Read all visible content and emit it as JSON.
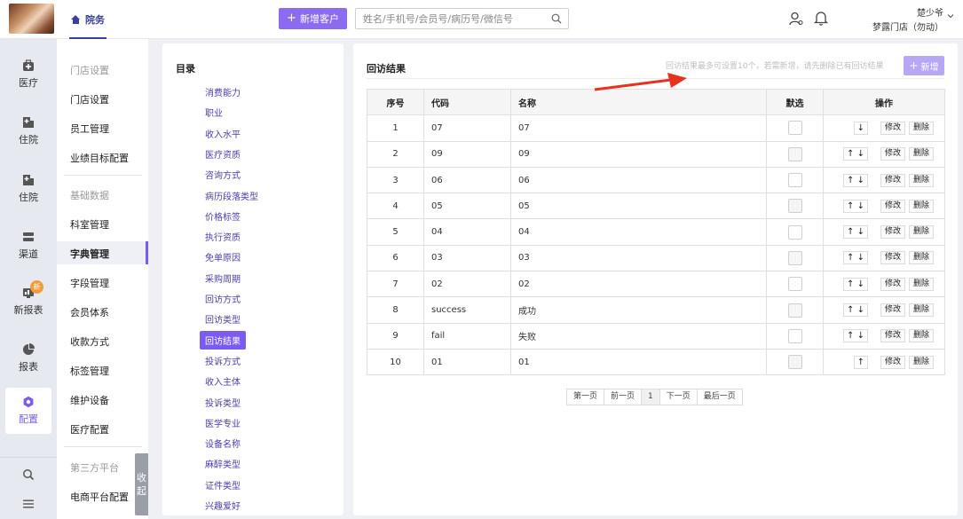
{
  "header": {
    "home_tab": "院务",
    "add_customer": "新增客户",
    "search_placeholder": "姓名/手机号/会员号/病历号/微信号",
    "user_name": "楚少爷",
    "store_name": "梦露门店（勿动）"
  },
  "nav": [
    {
      "label": "医疗",
      "icon": "medical-kit-icon"
    },
    {
      "label": "住院",
      "icon": "hospital-icon"
    },
    {
      "label": "住院",
      "icon": "hospital-icon"
    },
    {
      "label": "渠道",
      "icon": "channel-icon"
    },
    {
      "label": "新报表",
      "icon": "report-icon",
      "badge": "新"
    },
    {
      "label": "报表",
      "icon": "pie-chart-icon"
    },
    {
      "label": "配置",
      "icon": "gear-icon",
      "active": true
    },
    {
      "label": "",
      "icon": "search-icon"
    },
    {
      "label": "",
      "icon": "menu-icon"
    }
  ],
  "submenu": {
    "items": [
      "门店设置",
      "门店设置",
      "员工管理",
      "业绩目标配置",
      "基础数据",
      "科室管理",
      "字典管理",
      "字段管理",
      "会员体系",
      "收款方式",
      "标签管理",
      "维护设备",
      "医疗配置",
      "第三方平台",
      "电商平台配置"
    ],
    "collapse": [
      "收",
      "起"
    ]
  },
  "directory": {
    "title": "目录",
    "items": [
      "消费能力",
      "职业",
      "收入水平",
      "医疗资质",
      "咨询方式",
      "病历段落类型",
      "价格标签",
      "执行资质",
      "免单原因",
      "采购周期",
      "回访方式",
      "回访类型",
      "回访结果",
      "投诉方式",
      "收入主体",
      "投诉类型",
      "医学专业",
      "设备名称",
      "麻醉类型",
      "证件类型",
      "兴趣爱好"
    ],
    "active_index": 12
  },
  "results": {
    "title": "回访结果",
    "hint": "回访结果最多可设置10个，若需新增，请先删除已有回访结果",
    "add_label": "新增",
    "columns": [
      "序号",
      "代码",
      "名称",
      "默选",
      "操作"
    ],
    "rows": [
      {
        "no": "1",
        "code": "07",
        "name": "07",
        "arrows": "↓",
        "disabled": false
      },
      {
        "no": "2",
        "code": "09",
        "name": "09",
        "arrows": "↑ ↓",
        "disabled": true
      },
      {
        "no": "3",
        "code": "06",
        "name": "06",
        "arrows": "↑ ↓",
        "disabled": false
      },
      {
        "no": "4",
        "code": "05",
        "name": "05",
        "arrows": "↑ ↓",
        "disabled": true
      },
      {
        "no": "5",
        "code": "04",
        "name": "04",
        "arrows": "↑ ↓",
        "disabled": false
      },
      {
        "no": "6",
        "code": "03",
        "name": "03",
        "arrows": "↑ ↓",
        "disabled": true
      },
      {
        "no": "7",
        "code": "02",
        "name": "02",
        "arrows": "↑ ↓",
        "disabled": false
      },
      {
        "no": "8",
        "code": "success",
        "name": "成功",
        "arrows": "↑ ↓",
        "disabled": true
      },
      {
        "no": "9",
        "code": "fail",
        "name": "失败",
        "arrows": "↑ ↓",
        "disabled": false
      },
      {
        "no": "10",
        "code": "01",
        "name": "01",
        "arrows": "↑",
        "disabled": true
      }
    ],
    "edit_label": "修改",
    "delete_label": "删除",
    "pager": [
      "第一页",
      "前一页",
      "1",
      "下一页",
      "最后一页"
    ]
  },
  "colors": {
    "accent": "#7b5cf0",
    "primary_button": "#8b6cf0",
    "annotation_arrow": "#e8321e"
  }
}
